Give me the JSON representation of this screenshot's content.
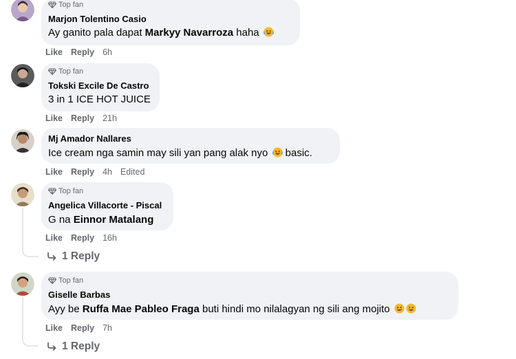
{
  "badge": {
    "label": "Top fan"
  },
  "actions": {
    "like": "Like",
    "reply": "Reply"
  },
  "comments": [
    {
      "author": "Marjon Tolentino Casio",
      "top_fan": true,
      "text_before": "Ay ganito pala dapat ",
      "mention": "Markyy Navarroza",
      "text_after": " haha",
      "emoji": "laughing-tears",
      "time": "6h"
    },
    {
      "author": "Tokski Excile De Castro",
      "top_fan": true,
      "text": "3 in 1 ICE HOT JUICE",
      "time": "21h"
    },
    {
      "author": "Mj Amador Nallares",
      "top_fan": false,
      "text_before": "Ice cream nga samin may sili yan pang alak nyo ",
      "text_after": " basic.",
      "emoji": "laughing-tears",
      "time": "4h",
      "edited": "Edited"
    },
    {
      "author": "Angelica Villacorte - Piscal",
      "top_fan": true,
      "text_before": "G na ",
      "mention": "Einnor Matalang",
      "time": "16h",
      "replies": "1 Reply"
    },
    {
      "author": "Giselle Barbas",
      "top_fan": true,
      "text_before": "Ayy be ",
      "mention": "Ruffa Mae Pableo Fraga",
      "text_after": " buti hindi mo nilalagyan ng sili ang mojito",
      "emoji": "grinning-squint",
      "time": "7h",
      "replies": "1 Reply"
    }
  ]
}
